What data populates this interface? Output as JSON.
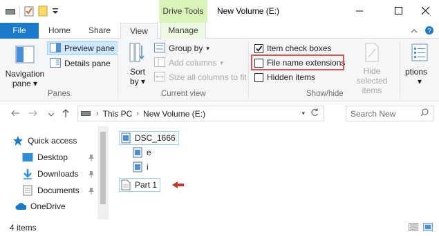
{
  "window": {
    "title": "New Volume (E:)",
    "contextual_tab": "Drive Tools",
    "controls": [
      "minimize-icon",
      "maximize-icon",
      "close-icon"
    ]
  },
  "ribbon_tabs": [
    {
      "label": "File"
    },
    {
      "label": "Home"
    },
    {
      "label": "Share"
    },
    {
      "label": "View"
    },
    {
      "label": "Manage"
    }
  ],
  "ribbon": {
    "panes": {
      "navigation_pane": "Navigation",
      "navigation_pane_2": "pane",
      "preview_pane": "Preview pane",
      "details_pane": "Details pane",
      "label": "Panes"
    },
    "current_view": {
      "sort_by": "Sort",
      "sort_by_2": "by",
      "group_by": "Group by",
      "add_columns": "Add columns",
      "size_all_columns": "Size all columns to fit",
      "label": "Current view"
    },
    "show_hide": {
      "item_check_boxes": "Item check boxes",
      "item_check_boxes_checked": true,
      "file_name_extensions": "File name extensions",
      "file_name_extensions_checked": false,
      "hidden_items": "Hidden items",
      "hidden_items_checked": false,
      "hide_selected": "Hide selected",
      "hide_selected_2": "items",
      "label": "Show/hide"
    },
    "options": "ptions"
  },
  "address": {
    "crumbs": [
      "This PC",
      "New Volume (E:)"
    ],
    "search_placeholder": "Search New"
  },
  "nav_pane": {
    "items": [
      {
        "label": "Quick access",
        "icon": "star-icon"
      },
      {
        "label": "Desktop",
        "icon": "desktop-folder-icon",
        "pinned": true
      },
      {
        "label": "Downloads",
        "icon": "downloads-icon",
        "pinned": true
      },
      {
        "label": "Documents",
        "icon": "documents-icon",
        "pinned": true
      },
      {
        "label": "OneDrive",
        "icon": "onedrive-icon"
      }
    ]
  },
  "files": [
    {
      "name": "DSC_1666",
      "type": "image"
    },
    {
      "name": "e",
      "type": "image"
    },
    {
      "name": "i",
      "type": "image"
    },
    {
      "name": "Part 1",
      "type": "document"
    }
  ],
  "status": {
    "item_count": "4 items"
  },
  "colors": {
    "file_tab": "#1979ca",
    "contextual_tab": "#d9f3b9",
    "highlight": "#d9534f",
    "selection": "#cde8ff"
  }
}
